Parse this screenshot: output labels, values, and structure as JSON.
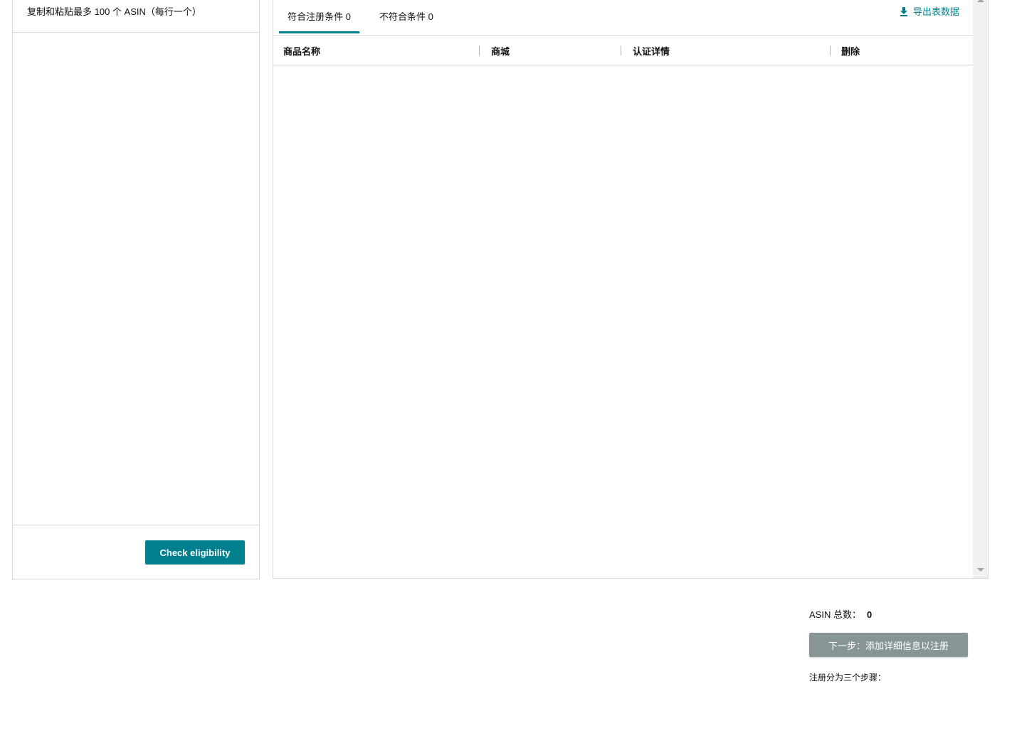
{
  "left_panel": {
    "hint": "复制和粘贴最多 100 个 ASIN（每行一个）",
    "textarea_value": "",
    "check_button_label": "Check eligibility"
  },
  "right_panel": {
    "tabs": [
      {
        "label": "符合注册条件 0",
        "active": true
      },
      {
        "label": "不符合条件 0",
        "active": false
      }
    ],
    "export_label": "导出表数据",
    "export_icon": "download-icon",
    "columns": [
      "商品名称",
      "商城",
      "认证详情",
      "删除"
    ],
    "rows": []
  },
  "summary": {
    "label": "ASIN 总数：",
    "count": "0"
  },
  "next_button_label": "下一步：添加详细信息以注册",
  "steps_text": "注册分为三个步骤：",
  "colors": {
    "accent": "#00808f",
    "disabled_button": "#879596",
    "border": "#d5d9d9"
  }
}
